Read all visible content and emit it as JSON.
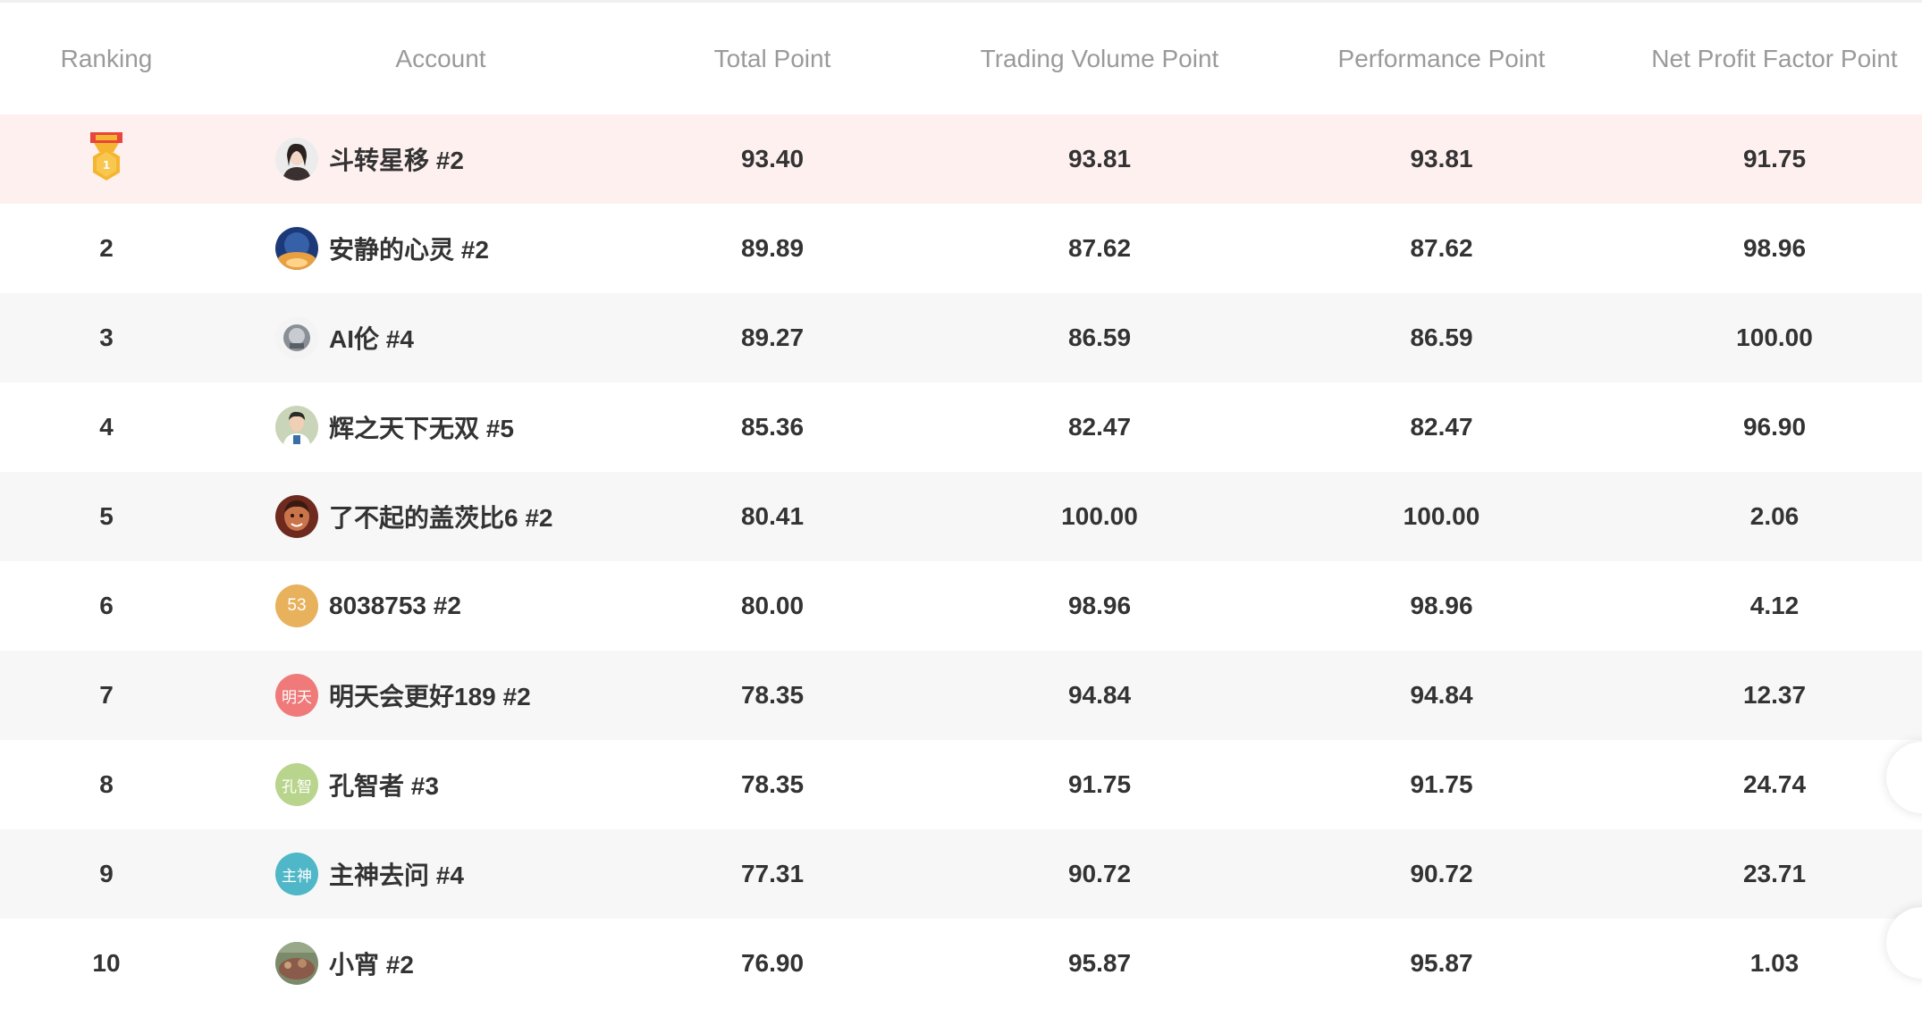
{
  "table": {
    "headers": {
      "ranking": "Ranking",
      "account": "Account",
      "total_point": "Total Point",
      "trading_volume_point": "Trading Volume Point",
      "performance_point": "Performance Point",
      "net_profit_factor_point": "Net Profit Factor Point"
    },
    "rows": [
      {
        "rank": "1",
        "account": "斗转星移 #2",
        "avatar_icon": "photo-avatar-icon",
        "avatar_text": "",
        "total": "93.40",
        "volume": "93.81",
        "performance": "93.81",
        "npf": "91.75"
      },
      {
        "rank": "2",
        "account": "安静的心灵 #2",
        "avatar_icon": "photo-avatar-icon",
        "avatar_text": "",
        "total": "89.89",
        "volume": "87.62",
        "performance": "87.62",
        "npf": "98.96"
      },
      {
        "rank": "3",
        "account": "AI伦 #4",
        "avatar_icon": "photo-avatar-icon",
        "avatar_text": "",
        "total": "89.27",
        "volume": "86.59",
        "performance": "86.59",
        "npf": "100.00"
      },
      {
        "rank": "4",
        "account": "辉之天下无双 #5",
        "avatar_icon": "photo-avatar-icon",
        "avatar_text": "",
        "total": "85.36",
        "volume": "82.47",
        "performance": "82.47",
        "npf": "96.90"
      },
      {
        "rank": "5",
        "account": "了不起的盖茨比6 #2",
        "avatar_icon": "photo-avatar-icon",
        "avatar_text": "",
        "total": "80.41",
        "volume": "100.00",
        "performance": "100.00",
        "npf": "2.06"
      },
      {
        "rank": "6",
        "account": "8038753 #2",
        "avatar_icon": "text-avatar-icon",
        "avatar_text": "53",
        "total": "80.00",
        "volume": "98.96",
        "performance": "98.96",
        "npf": "4.12"
      },
      {
        "rank": "7",
        "account": "明天会更好189 #2",
        "avatar_icon": "text-avatar-icon",
        "avatar_text": "明天",
        "total": "78.35",
        "volume": "94.84",
        "performance": "94.84",
        "npf": "12.37"
      },
      {
        "rank": "8",
        "account": "孔智者 #3",
        "avatar_icon": "text-avatar-icon",
        "avatar_text": "孔智",
        "total": "78.35",
        "volume": "91.75",
        "performance": "91.75",
        "npf": "24.74"
      },
      {
        "rank": "9",
        "account": "主神去问 #4",
        "avatar_icon": "text-avatar-icon",
        "avatar_text": "主神",
        "total": "77.31",
        "volume": "90.72",
        "performance": "90.72",
        "npf": "23.71"
      },
      {
        "rank": "10",
        "account": "小宵 #2",
        "avatar_icon": "photo-avatar-icon",
        "avatar_text": "",
        "total": "76.90",
        "volume": "95.87",
        "performance": "95.87",
        "npf": "1.03"
      }
    ]
  },
  "colors": {
    "top1_row_bg": "#fff0f0",
    "alt_row_bg": "#f7f7f7",
    "header_text": "#9a9a9a",
    "cell_text": "#333333",
    "medal_gold": "#f5b531",
    "medal_ribbon": "#e8453c",
    "avatar_6": "#e8b15c",
    "avatar_7": "#f07a7a",
    "avatar_8": "#b9d48c",
    "avatar_9": "#4fb7c7"
  },
  "icons": {
    "rank1": "gold-medal-icon"
  }
}
